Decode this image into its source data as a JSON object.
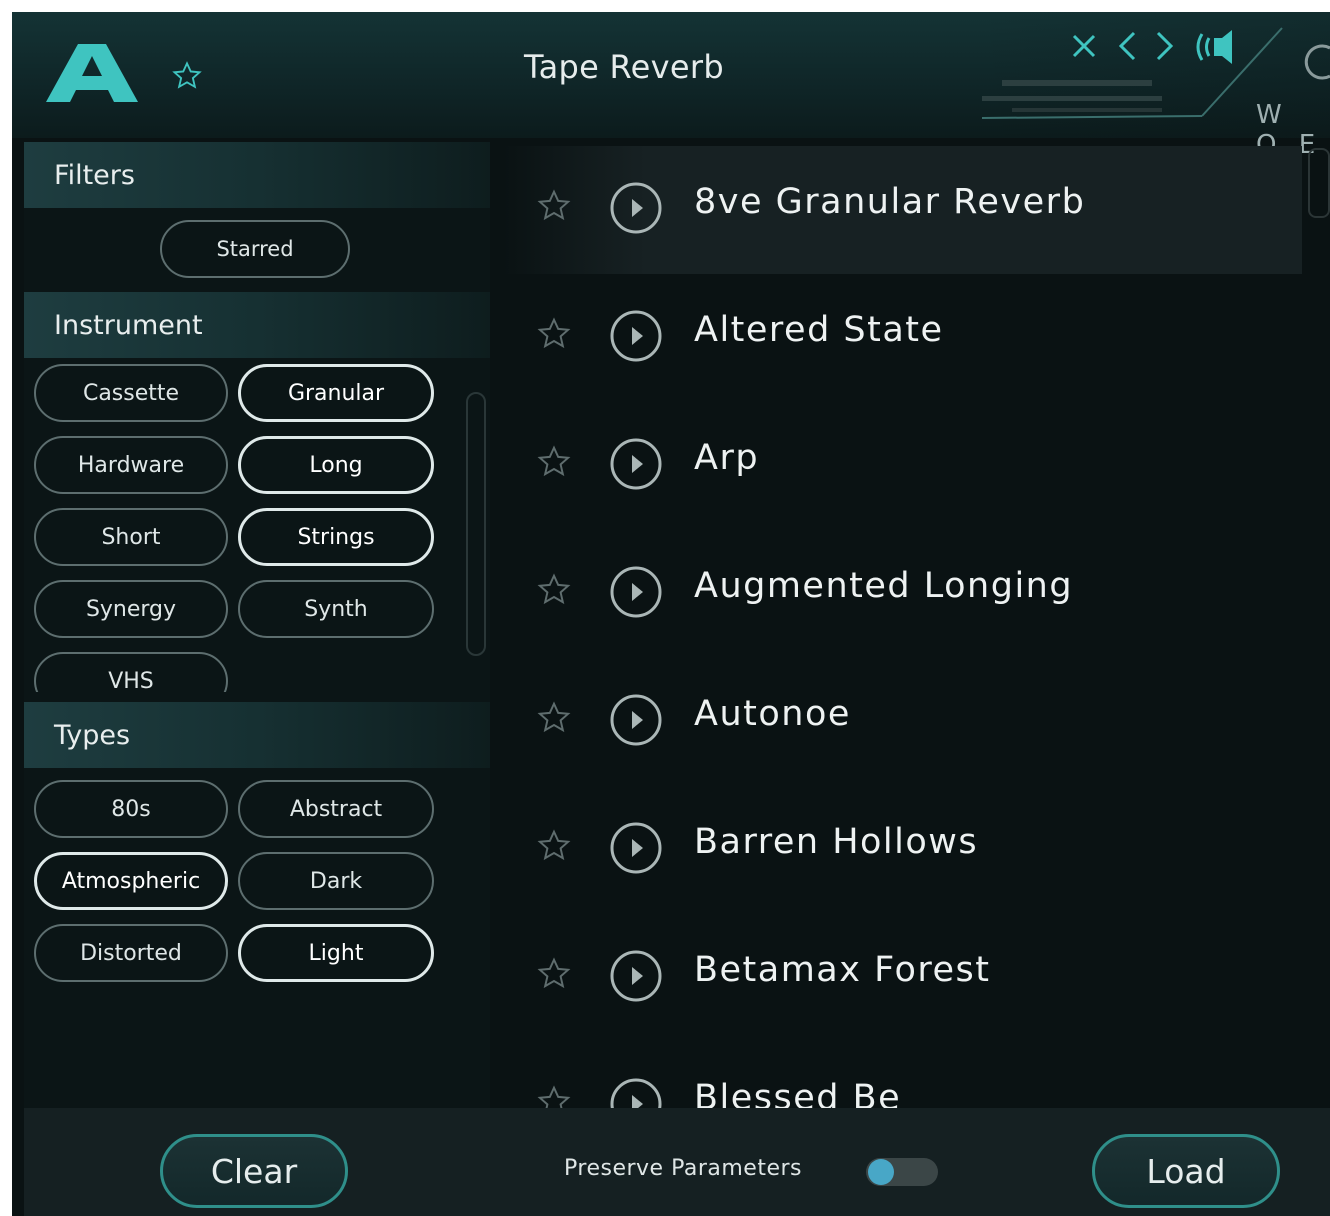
{
  "header": {
    "title": "Tape Reverb",
    "logo_letter": "A",
    "side_label": "W O E"
  },
  "filters": {
    "title": "Filters",
    "starred_label": "Starred"
  },
  "instrument": {
    "title": "Instrument",
    "items": [
      {
        "label": "Cassette",
        "active": false
      },
      {
        "label": "Granular",
        "active": true
      },
      {
        "label": "Hardware",
        "active": false
      },
      {
        "label": "Long",
        "active": true
      },
      {
        "label": "Short",
        "active": false
      },
      {
        "label": "Strings",
        "active": true
      },
      {
        "label": "Synergy",
        "active": false
      },
      {
        "label": "Synth",
        "active": false
      },
      {
        "label": "VHS",
        "active": false
      }
    ]
  },
  "types": {
    "title": "Types",
    "items": [
      {
        "label": "80s",
        "active": false
      },
      {
        "label": "Abstract",
        "active": false
      },
      {
        "label": "Atmospheric",
        "active": true
      },
      {
        "label": "Dark",
        "active": false
      },
      {
        "label": "Distorted",
        "active": false
      },
      {
        "label": "Light",
        "active": true
      }
    ]
  },
  "presets": [
    {
      "name": "8ve Granular Reverb",
      "selected": true
    },
    {
      "name": "Altered State",
      "selected": false
    },
    {
      "name": "Arp",
      "selected": false
    },
    {
      "name": "Augmented Longing",
      "selected": false
    },
    {
      "name": "Autonoe",
      "selected": false
    },
    {
      "name": "Barren Hollows",
      "selected": false
    },
    {
      "name": "Betamax Forest",
      "selected": false
    },
    {
      "name": "Blessed Be",
      "selected": false
    }
  ],
  "footer": {
    "clear_label": "Clear",
    "preserve_label": "Preserve Parameters",
    "preserve_on": false,
    "load_label": "Load"
  },
  "colors": {
    "accent": "#3fc4c0",
    "background": "#0a1213",
    "button_border": "#2f8f8a",
    "toggle_knob": "#48a7c7"
  }
}
